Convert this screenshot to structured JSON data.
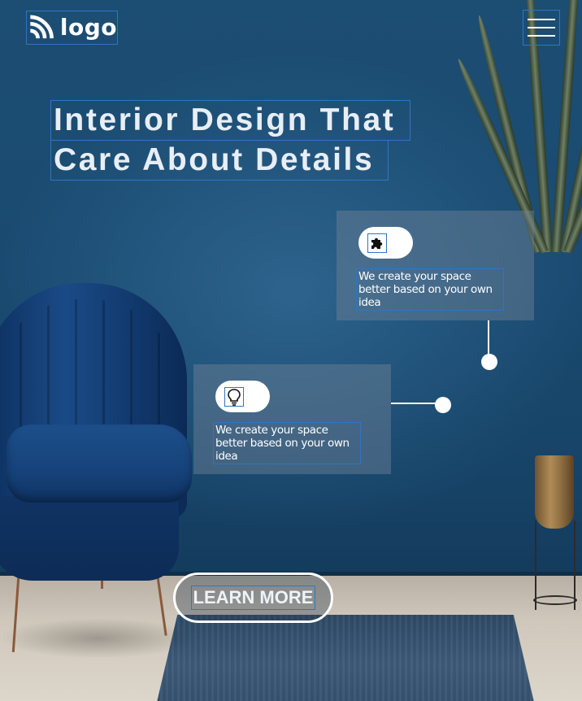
{
  "header": {
    "logo_text": "logo",
    "logo_icon": "rss-feed-icon",
    "menu_icon": "hamburger-menu-icon"
  },
  "hero": {
    "title_line1": "Interior Design That",
    "title_line2": "Care About Details"
  },
  "features": [
    {
      "icon": "puzzle-piece-icon",
      "text": "We create your space better based on your own idea"
    },
    {
      "icon": "lightbulb-icon",
      "text": "We create your space better based on your own idea"
    }
  ],
  "cta": {
    "label": "LEARN MORE"
  },
  "colors": {
    "background": "#1a4a70",
    "outline_accent": "#2e76c4",
    "text": "#ffffff"
  }
}
